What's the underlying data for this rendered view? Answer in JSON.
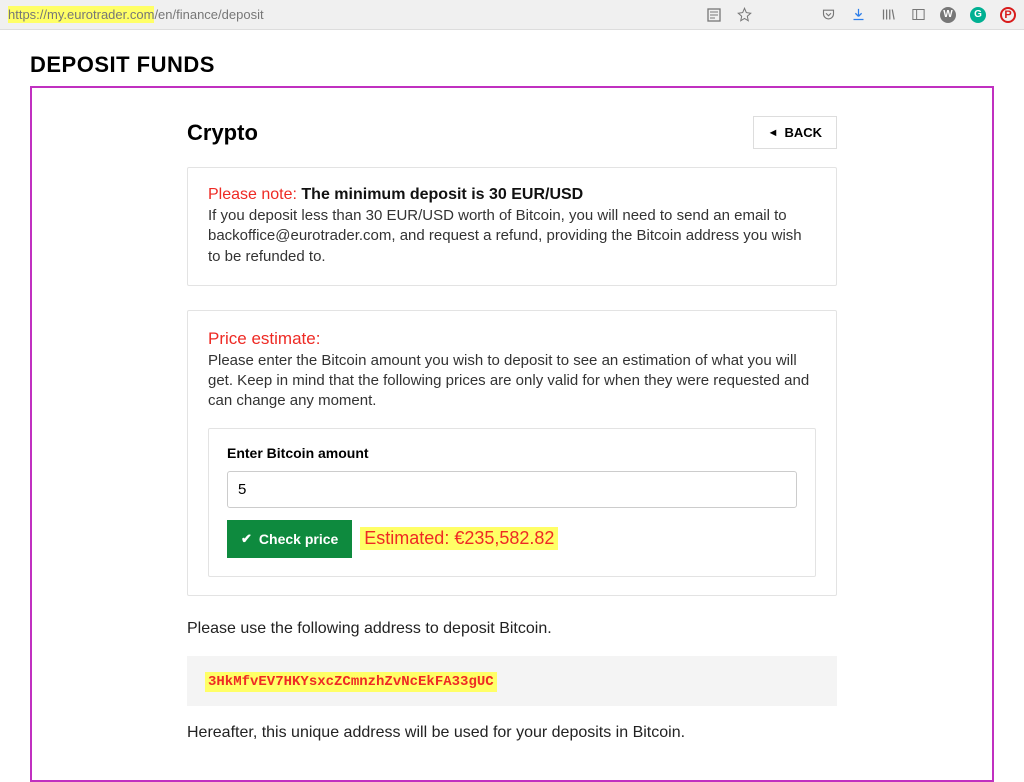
{
  "browser": {
    "url_prefix": "https://my.eurotrader.com",
    "url_suffix": "/en/finance/deposit"
  },
  "page": {
    "title": "DEPOSIT FUNDS",
    "section_title": "Crypto",
    "back_label": "BACK"
  },
  "note": {
    "label": "Please note:",
    "headline": "The minimum deposit is 30 EUR/USD",
    "body": "If you deposit less than 30 EUR/USD worth of Bitcoin, you will need to send an email to backoffice@eurotrader.com, and request a refund, providing the Bitcoin address you wish to be refunded to."
  },
  "price": {
    "title": "Price estimate:",
    "body": "Please enter the Bitcoin amount you wish to deposit to see an estimation of what you will get. Keep in mind that the following prices are only valid for when they were requested and can change any moment.",
    "input_label": "Enter Bitcoin amount",
    "input_value": "5",
    "check_label": "Check price",
    "estimated_label": "Estimated: €235,582.82"
  },
  "deposit": {
    "intro": "Please use the following address to deposit Bitcoin.",
    "address": "3HkMfvEV7HKYsxcZCmnzhZvNcEkFA33gUC",
    "after": "Hereafter, this unique address will be used for your deposits in Bitcoin."
  }
}
